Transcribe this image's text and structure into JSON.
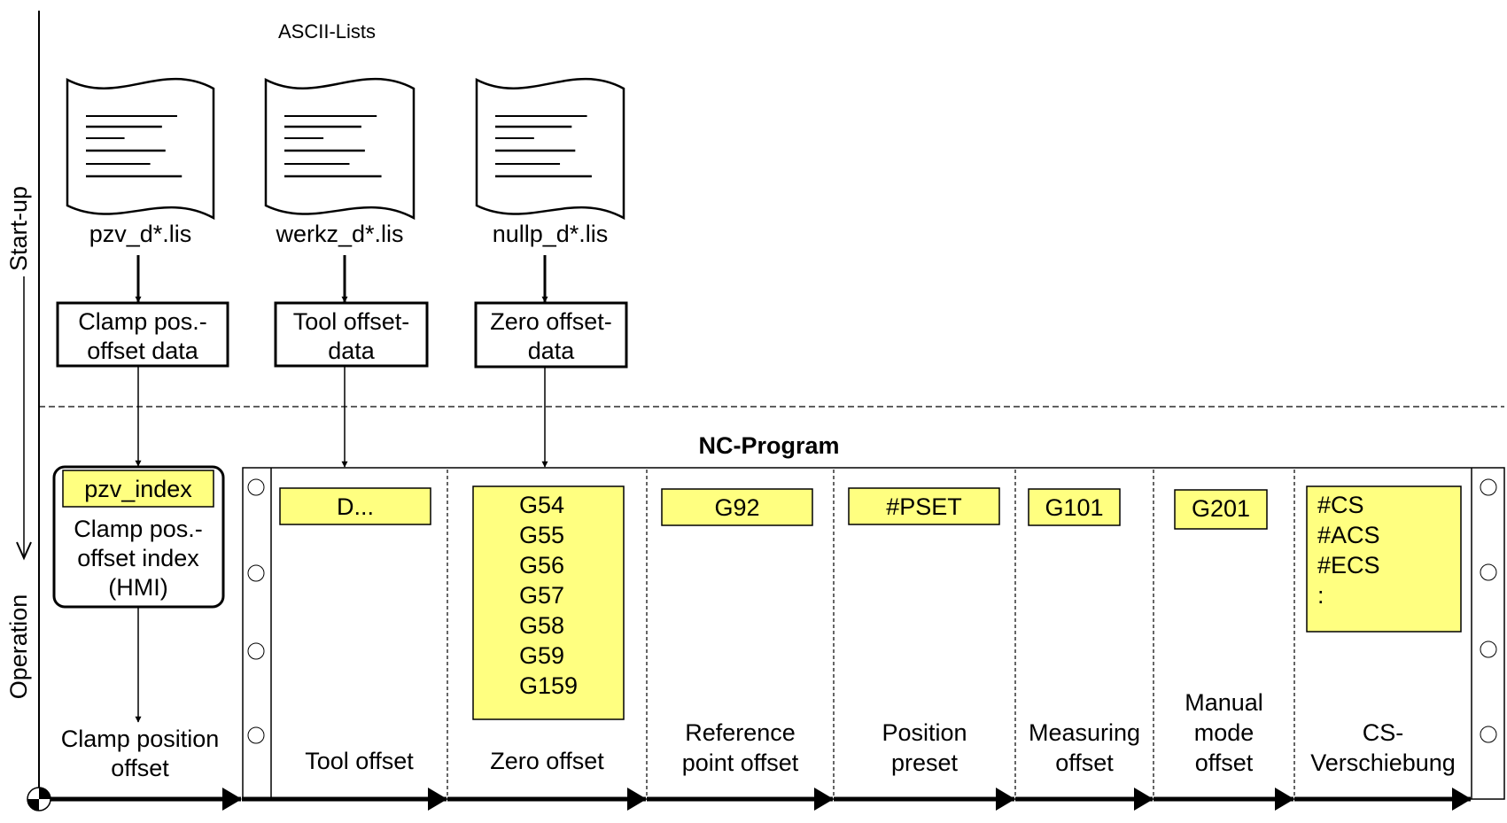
{
  "phases": {
    "startup": "Start-up",
    "operation": "Operation"
  },
  "ascii_lists": {
    "title": "ASCII-Lists",
    "files": [
      {
        "name": "pzv_d*.lis",
        "data_box": [
          "Clamp pos.-",
          "offset data"
        ]
      },
      {
        "name": "werkz_d*.lis",
        "data_box": [
          "Tool offset-",
          "data"
        ]
      },
      {
        "name": "nullp_d*.lis",
        "data_box": [
          "Zero offset-",
          "data"
        ]
      }
    ]
  },
  "hmi": {
    "code": "pzv_index",
    "lines": [
      "Clamp pos.-",
      "offset index",
      "(HMI)"
    ],
    "result": [
      "Clamp position",
      "offset"
    ]
  },
  "nc_program": {
    "title": "NC-Program",
    "sections": [
      {
        "codes": [
          "D..."
        ],
        "label": [
          "Tool offset"
        ]
      },
      {
        "codes": [
          "G54",
          "G55",
          "G56",
          "G57",
          "G58",
          "G59",
          "G159"
        ],
        "label": [
          "Zero offset"
        ]
      },
      {
        "codes": [
          "G92"
        ],
        "label": [
          "Reference",
          "point offset"
        ]
      },
      {
        "codes": [
          "#PSET"
        ],
        "label": [
          "Position",
          "preset"
        ]
      },
      {
        "codes": [
          "G101"
        ],
        "label": [
          "Measuring",
          "offset"
        ]
      },
      {
        "codes": [
          "G201"
        ],
        "label": [
          "Manual",
          "mode",
          "offset"
        ]
      },
      {
        "codes": [
          "#CS",
          "#ACS",
          "#ECS",
          ":"
        ],
        "label": [
          "CS-",
          "Verschiebung"
        ]
      }
    ]
  },
  "colors": {
    "highlight": "#FFFF80",
    "line": "#000000"
  }
}
